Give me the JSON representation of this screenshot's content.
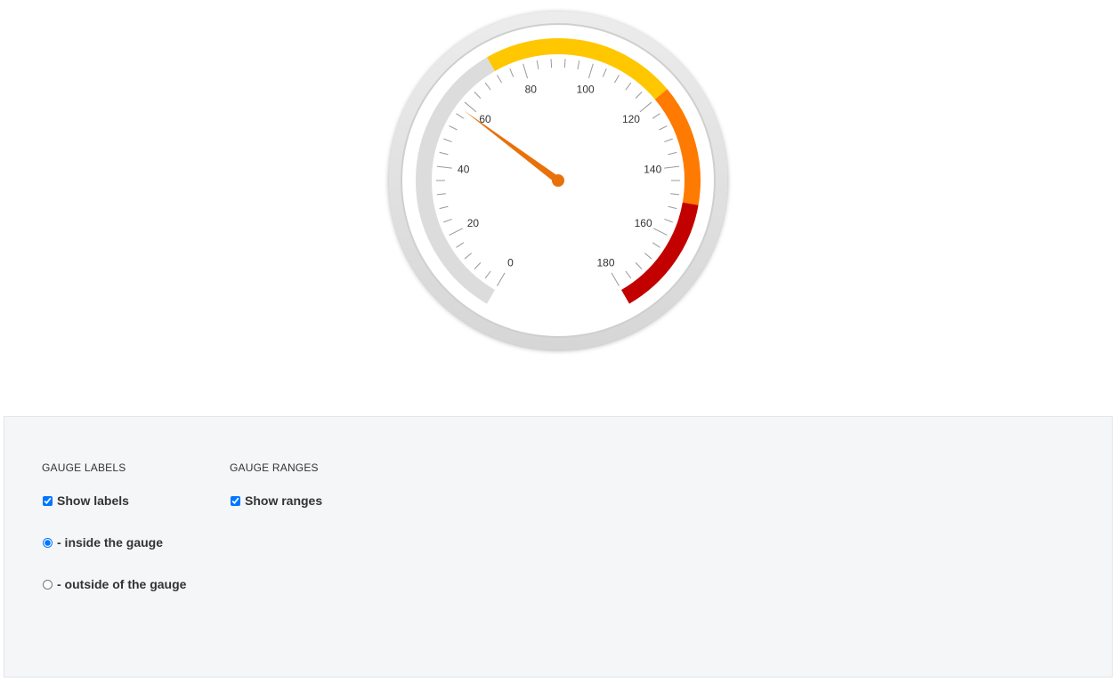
{
  "gauge": {
    "value": 58,
    "min": 0,
    "max": 180,
    "major_step": 20,
    "minor_step": 4,
    "labels": [
      "0",
      "20",
      "40",
      "60",
      "80",
      "100",
      "120",
      "140",
      "160",
      "180"
    ],
    "ranges": [
      {
        "from": 0,
        "to": 72,
        "color": "#dcdcdc"
      },
      {
        "from": 72,
        "to": 120,
        "color": "#ffc700"
      },
      {
        "from": 120,
        "to": 150,
        "color": "#ff7a00"
      },
      {
        "from": 150,
        "to": 180,
        "color": "#c20000"
      }
    ],
    "colors": {
      "needle": "#e8710a",
      "frame": "#dedede",
      "tick": "#999999",
      "label": "#333333",
      "face": "#ffffff"
    }
  },
  "options": {
    "labels_section": {
      "heading": "GAUGE LABELS",
      "show_labels": {
        "label": "Show labels",
        "checked": true
      },
      "position_inside": {
        "label": "- inside the gauge",
        "checked": true
      },
      "position_outside": {
        "label": "- outside of the gauge",
        "checked": false
      }
    },
    "ranges_section": {
      "heading": "GAUGE RANGES",
      "show_ranges": {
        "label": "Show ranges",
        "checked": true
      }
    }
  }
}
